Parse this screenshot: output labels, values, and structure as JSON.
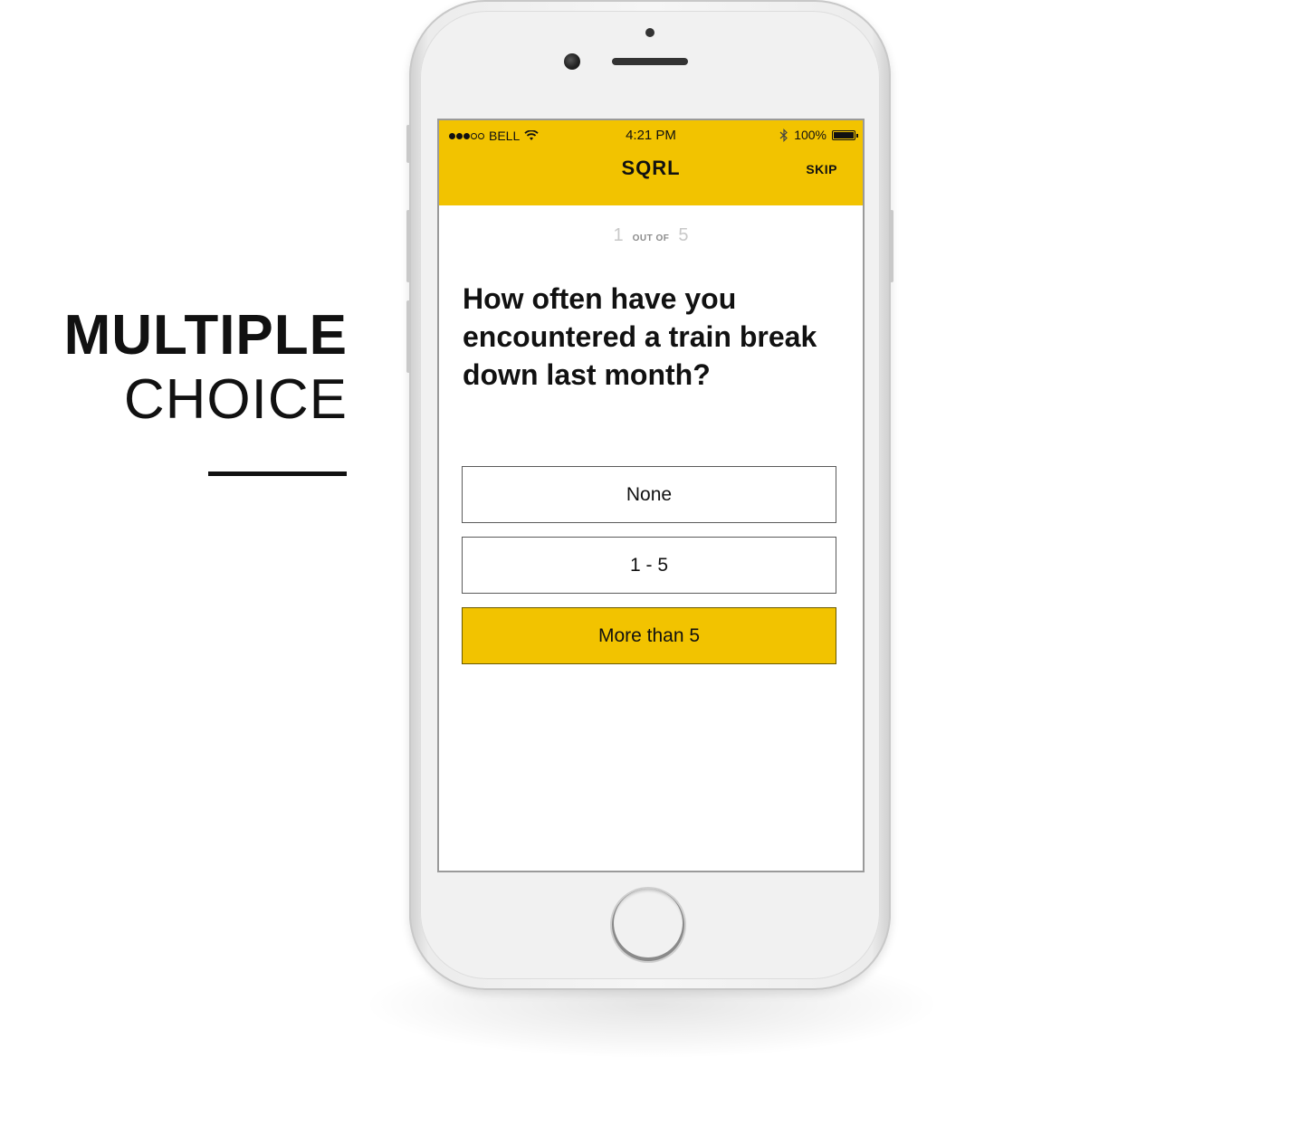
{
  "caption": {
    "line1": "MULTIPLE",
    "line2": "CHOICE"
  },
  "status_bar": {
    "carrier": "BELL",
    "time": "4:21 PM",
    "battery": "100%",
    "signal_bars_filled": 3,
    "signal_bars_total": 5
  },
  "nav": {
    "title": "SQRL",
    "skip_label": "SKIP"
  },
  "progress": {
    "current": "1",
    "label": "OUT OF",
    "total": "5"
  },
  "question": {
    "text": "How often have you encountered a train break down last month?"
  },
  "options": [
    {
      "label": "None",
      "selected": false
    },
    {
      "label": "1 - 5",
      "selected": false
    },
    {
      "label": "More than 5",
      "selected": true
    }
  ],
  "colors": {
    "accent": "#f2c300",
    "text": "#111111",
    "muted": "#c8c8c8"
  }
}
